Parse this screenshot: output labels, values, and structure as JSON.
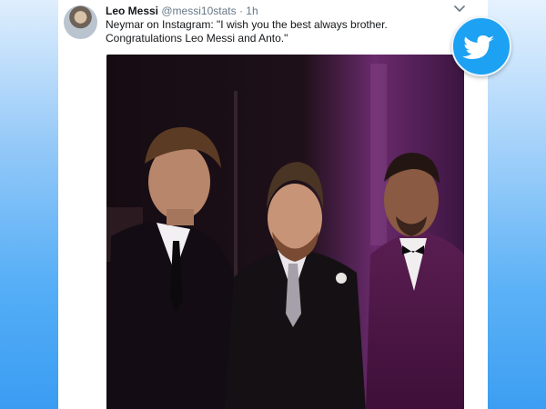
{
  "tweet": {
    "author_name": "Leo Messi",
    "author_handle": "@messi10stats",
    "separator": "·",
    "time": "1h",
    "text": "Neymar on Instagram: \"I wish you the best always brother. Congratulations Leo Messi and Anto.\""
  },
  "icons": {
    "menu": "chevron-down-icon",
    "brand": "twitter-bird-icon"
  },
  "colors": {
    "twitter_blue": "#1da1f2",
    "name_text": "#14171a",
    "muted_text": "#657786",
    "background_blue": "#3b9ef3"
  }
}
